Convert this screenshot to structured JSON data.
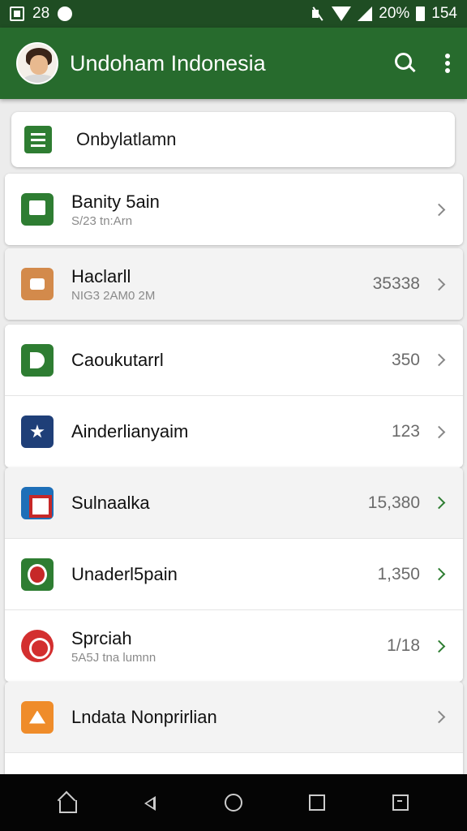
{
  "status_bar": {
    "time": "28",
    "battery": "20%",
    "right_text": "154"
  },
  "app_bar": {
    "title": "Undoham Indonesia"
  },
  "filter": {
    "label": "Onbylatlamn"
  },
  "cards": [
    {
      "rows": [
        {
          "icon": "document-icon",
          "icon_color": "#2e7d32",
          "title": "Banity 5ain",
          "subtitle": "S/23 tn:Arn",
          "value": "",
          "chevron": "gray"
        }
      ]
    },
    {
      "rows": [
        {
          "icon": "bag-icon",
          "icon_color": "#d38a4b",
          "title": "Haclarll",
          "subtitle": "NIG3 2AM0 2M",
          "value": "35338",
          "chevron": "gray",
          "shade": true
        }
      ]
    },
    {
      "rows": [
        {
          "icon": "d-icon",
          "icon_color": "#2e7d32",
          "title": "Caoukutarrl",
          "subtitle": "",
          "value": "350",
          "chevron": "gray"
        },
        {
          "icon": "star-icon",
          "icon_color": "#1f3f78",
          "title": "Ainderlianyaim",
          "subtitle": "",
          "value": "123",
          "chevron": "gray"
        }
      ]
    },
    {
      "rows": [
        {
          "icon": "frame-icon",
          "icon_color": "#1e6fb8",
          "title": "Sulnaalka",
          "subtitle": "",
          "value": "15,380",
          "chevron": "green",
          "shade": true
        },
        {
          "icon": "shield-icon",
          "icon_color": "#2e7d32",
          "title": "Unaderl5pain",
          "subtitle": "",
          "value": "1,350",
          "chevron": "green"
        },
        {
          "icon": "clock-icon",
          "icon_color": "#d32f2f",
          "title": "Sprciah",
          "subtitle": "5A5J tna lumnn",
          "value": "1/18",
          "chevron": "green"
        }
      ]
    },
    {
      "rows": [
        {
          "icon": "warning-icon",
          "icon_color": "#ef8c2a",
          "title": "Lndata Nonprirlian",
          "subtitle": "",
          "value": "",
          "chevron": "gray",
          "shade": true
        },
        {
          "icon": "",
          "icon_color": "",
          "title": "",
          "subtitle": "",
          "value": "",
          "chevron": ""
        }
      ]
    }
  ]
}
